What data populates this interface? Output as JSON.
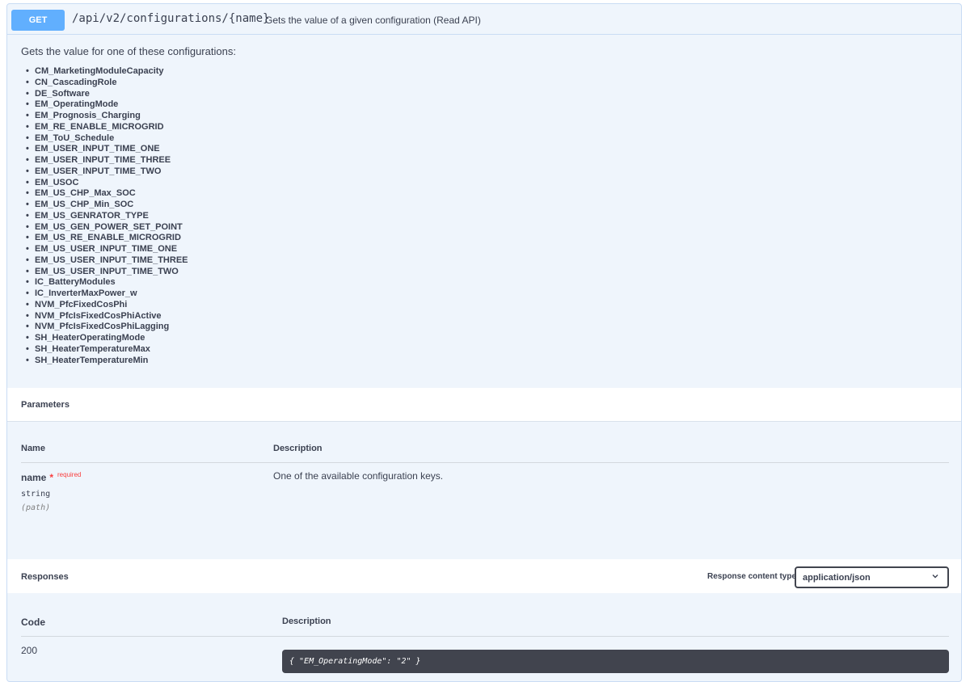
{
  "operation": {
    "method": "GET",
    "path": "/api/v2/configurations/{name}",
    "summary": "Gets the value of a given configuration (Read API)"
  },
  "description": {
    "intro": "Gets the value for one of these configurations:",
    "configurations": [
      "CM_MarketingModuleCapacity",
      "CN_CascadingRole",
      "DE_Software",
      "EM_OperatingMode",
      "EM_Prognosis_Charging",
      "EM_RE_ENABLE_MICROGRID",
      "EM_ToU_Schedule",
      "EM_USER_INPUT_TIME_ONE",
      "EM_USER_INPUT_TIME_THREE",
      "EM_USER_INPUT_TIME_TWO",
      "EM_USOC",
      "EM_US_CHP_Max_SOC",
      "EM_US_CHP_Min_SOC",
      "EM_US_GENRATOR_TYPE",
      "EM_US_GEN_POWER_SET_POINT",
      "EM_US_RE_ENABLE_MICROGRID",
      "EM_US_USER_INPUT_TIME_ONE",
      "EM_US_USER_INPUT_TIME_THREE",
      "EM_US_USER_INPUT_TIME_TWO",
      "IC_BatteryModules",
      "IC_InverterMaxPower_w",
      "NVM_PfcFixedCosPhi",
      "NVM_PfcIsFixedCosPhiActive",
      "NVM_PfcIsFixedCosPhiLagging",
      "SH_HeaterOperatingMode",
      "SH_HeaterTemperatureMax",
      "SH_HeaterTemperatureMin"
    ]
  },
  "parameters": {
    "title": "Parameters",
    "col_name": "Name",
    "col_description": "Description",
    "items": [
      {
        "name": "name",
        "required_star": "*",
        "required_label": "required",
        "type": "string",
        "in": "(path)",
        "description": "One of the available configuration keys."
      }
    ]
  },
  "responses": {
    "title": "Responses",
    "content_type_label": "Response content type",
    "content_type_value": "application/json",
    "col_code": "Code",
    "col_description": "Description",
    "items": [
      {
        "code": "200",
        "example": "{ \"EM_OperatingMode\": \"2\" }"
      }
    ]
  },
  "colors": {
    "get_method": "#61affe",
    "block_background": "#eff5fc",
    "required": "#f93e3e",
    "code_background": "#41444e"
  }
}
